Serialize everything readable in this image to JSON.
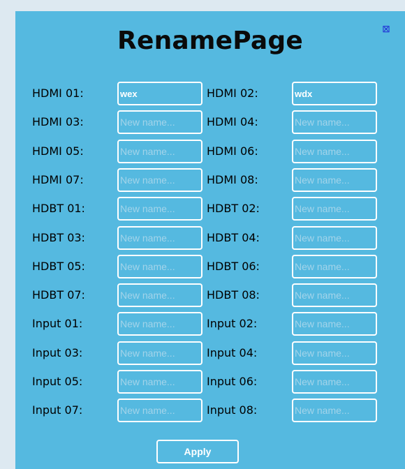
{
  "page": {
    "title": "RenamePage",
    "close_icon": "close-box-icon",
    "apply_label": "Apply"
  },
  "fields": [
    {
      "label": "HDMI 01:",
      "value": "wex",
      "placeholder": "New name..."
    },
    {
      "label": "HDMI 02:",
      "value": "wdx",
      "placeholder": "New name..."
    },
    {
      "label": "HDMI 03:",
      "value": "",
      "placeholder": "New name..."
    },
    {
      "label": "HDMI 04:",
      "value": "",
      "placeholder": "New name..."
    },
    {
      "label": "HDMI 05:",
      "value": "",
      "placeholder": "New name..."
    },
    {
      "label": "HDMI 06:",
      "value": "",
      "placeholder": "New name..."
    },
    {
      "label": "HDMI 07:",
      "value": "",
      "placeholder": "New name..."
    },
    {
      "label": "HDMI 08:",
      "value": "",
      "placeholder": "New name..."
    },
    {
      "label": "HDBT 01:",
      "value": "",
      "placeholder": "New name..."
    },
    {
      "label": "HDBT 02:",
      "value": "",
      "placeholder": "New name..."
    },
    {
      "label": "HDBT 03:",
      "value": "",
      "placeholder": "New name..."
    },
    {
      "label": "HDBT 04:",
      "value": "",
      "placeholder": "New name..."
    },
    {
      "label": "HDBT 05:",
      "value": "",
      "placeholder": "New name..."
    },
    {
      "label": "HDBT 06:",
      "value": "",
      "placeholder": "New name..."
    },
    {
      "label": "HDBT 07:",
      "value": "",
      "placeholder": "New name..."
    },
    {
      "label": "HDBT 08:",
      "value": "",
      "placeholder": "New name..."
    },
    {
      "label": "Input 01:",
      "value": "",
      "placeholder": "New name..."
    },
    {
      "label": "Input 02:",
      "value": "",
      "placeholder": "New name..."
    },
    {
      "label": "Input 03:",
      "value": "",
      "placeholder": "New name..."
    },
    {
      "label": "Input 04:",
      "value": "",
      "placeholder": "New name..."
    },
    {
      "label": "Input 05:",
      "value": "",
      "placeholder": "New name..."
    },
    {
      "label": "Input 06:",
      "value": "",
      "placeholder": "New name..."
    },
    {
      "label": "Input 07:",
      "value": "",
      "placeholder": "New name..."
    },
    {
      "label": "Input 08:",
      "value": "",
      "placeholder": "New name..."
    }
  ],
  "colors": {
    "panel_background": "#55b9e0",
    "page_background": "#dde9f1",
    "field_border": "#ffffff",
    "close_icon": "#1f2fd6"
  }
}
